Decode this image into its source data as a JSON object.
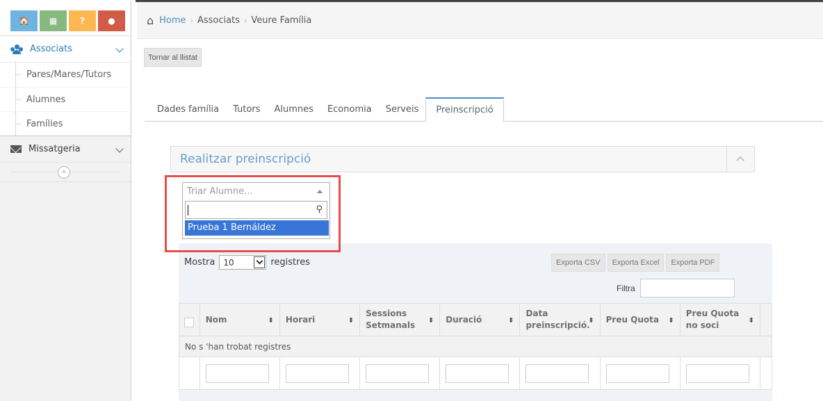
{
  "sidebar": {
    "shortcuts": [
      {
        "icon": "home-icon",
        "glyph": "🏠"
      },
      {
        "icon": "calendar-icon",
        "glyph": "▦"
      },
      {
        "icon": "question-icon",
        "glyph": "?"
      },
      {
        "icon": "comments-icon",
        "glyph": "●"
      }
    ],
    "sections": [
      {
        "label": "Associats",
        "open": true
      },
      {
        "label": "Missatgeria",
        "open": false
      }
    ],
    "submenu": [
      "Pares/Mares/Tutors",
      "Alumnes",
      "Famílies"
    ],
    "collapse_glyph": "«"
  },
  "breadcrumb": {
    "home": "Home",
    "section": "Associats",
    "current": "Veure Família",
    "sep": "›"
  },
  "back_button": "Tornar al llistat",
  "tabs": [
    "Dades família",
    "Tutors",
    "Alumnes",
    "Economia",
    "Serveis",
    "Preinscripció"
  ],
  "active_tab": "Preinscripció",
  "widget": {
    "title": "Realitzar preinscripció"
  },
  "dropdown": {
    "placeholder": "Triar Alumne...",
    "search_value": "",
    "options": [
      "Prueba 1 Bernáldez"
    ],
    "highlight_color": "#3875d7"
  },
  "table": {
    "length_label_before": "Mostra",
    "length_value": "10",
    "length_label_after": "registres",
    "export_buttons": [
      "Exporta CSV",
      "Exporta Excel",
      "Exporta PDF"
    ],
    "filter_label": "Filtra",
    "columns": [
      {
        "label": "Nom"
      },
      {
        "label": "Horari"
      },
      {
        "label": "Sessions Setmanals"
      },
      {
        "label": "Duració"
      },
      {
        "label": "Data preinscripció."
      },
      {
        "label": "Preu Quota"
      },
      {
        "label": "Preu Quota no soci"
      }
    ],
    "sort_glyph": "⬍",
    "empty_message": "No s 'han trobat registres"
  },
  "colors": {
    "accent": "#2b7dbc",
    "highlight_border": "#e94b4b"
  }
}
